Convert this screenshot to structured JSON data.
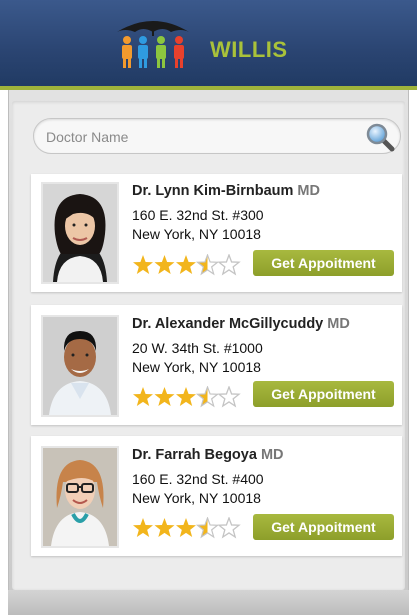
{
  "header": {
    "brand": "WILLIS",
    "logo_icon": "family-umbrella-icon",
    "accent": "#9fb43b",
    "brand_color": "#a9c23a",
    "bar_color": "#2a4471"
  },
  "search": {
    "placeholder": "Doctor Name",
    "value": "",
    "icon": "magnifier-icon"
  },
  "doctors": [
    {
      "name": "Dr. Lynn Kim-Birnbaum",
      "credential": "MD",
      "address_line1": "160 E. 32nd St. #300",
      "address_line2": "New York, NY 10018",
      "rating": 3.5,
      "rating_max": 5,
      "button_label": "Get Appoitment"
    },
    {
      "name": "Dr. Alexander McGillycuddy",
      "credential": "MD",
      "address_line1": "20 W. 34th St. #1000",
      "address_line2": "New York, NY 10018",
      "rating": 3.5,
      "rating_max": 5,
      "button_label": "Get Appoitment"
    },
    {
      "name": "Dr. Farrah Begoya",
      "credential": "MD",
      "address_line1": "160 E. 32nd St. #400",
      "address_line2": "New York, NY 10018",
      "rating": 3.5,
      "rating_max": 5,
      "button_label": "Get Appoitment"
    }
  ],
  "colors": {
    "star_filled": "#f2b51c",
    "star_empty": "#c4c4c4",
    "chevron": "#2f7fb8",
    "button": "#98aa32"
  }
}
